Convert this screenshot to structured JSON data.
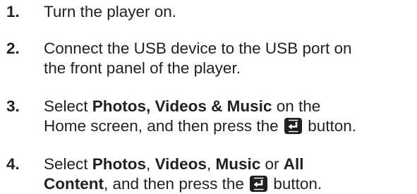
{
  "steps": [
    {
      "number": "1.",
      "lines": [
        [
          "Turn the player on."
        ]
      ]
    },
    {
      "number": "2.",
      "lines": [
        [
          "Connect the USB device to the USB port on"
        ],
        [
          "the front panel of the player."
        ]
      ]
    },
    {
      "number": "3.",
      "lines": [
        [
          "Select ",
          "Photos, Videos & Music",
          " on the"
        ],
        [
          "Home screen, and then press the ",
          " button."
        ]
      ]
    },
    {
      "number": "4.",
      "lines": [
        [
          "Select ",
          "Photos",
          ", ",
          "Videos",
          ", ",
          "Music",
          " or ",
          "All"
        ],
        [
          "Content",
          ", and then press the ",
          " button."
        ]
      ]
    }
  ],
  "icons": {
    "enter_button": "enter-icon",
    "color": "#231f20"
  }
}
